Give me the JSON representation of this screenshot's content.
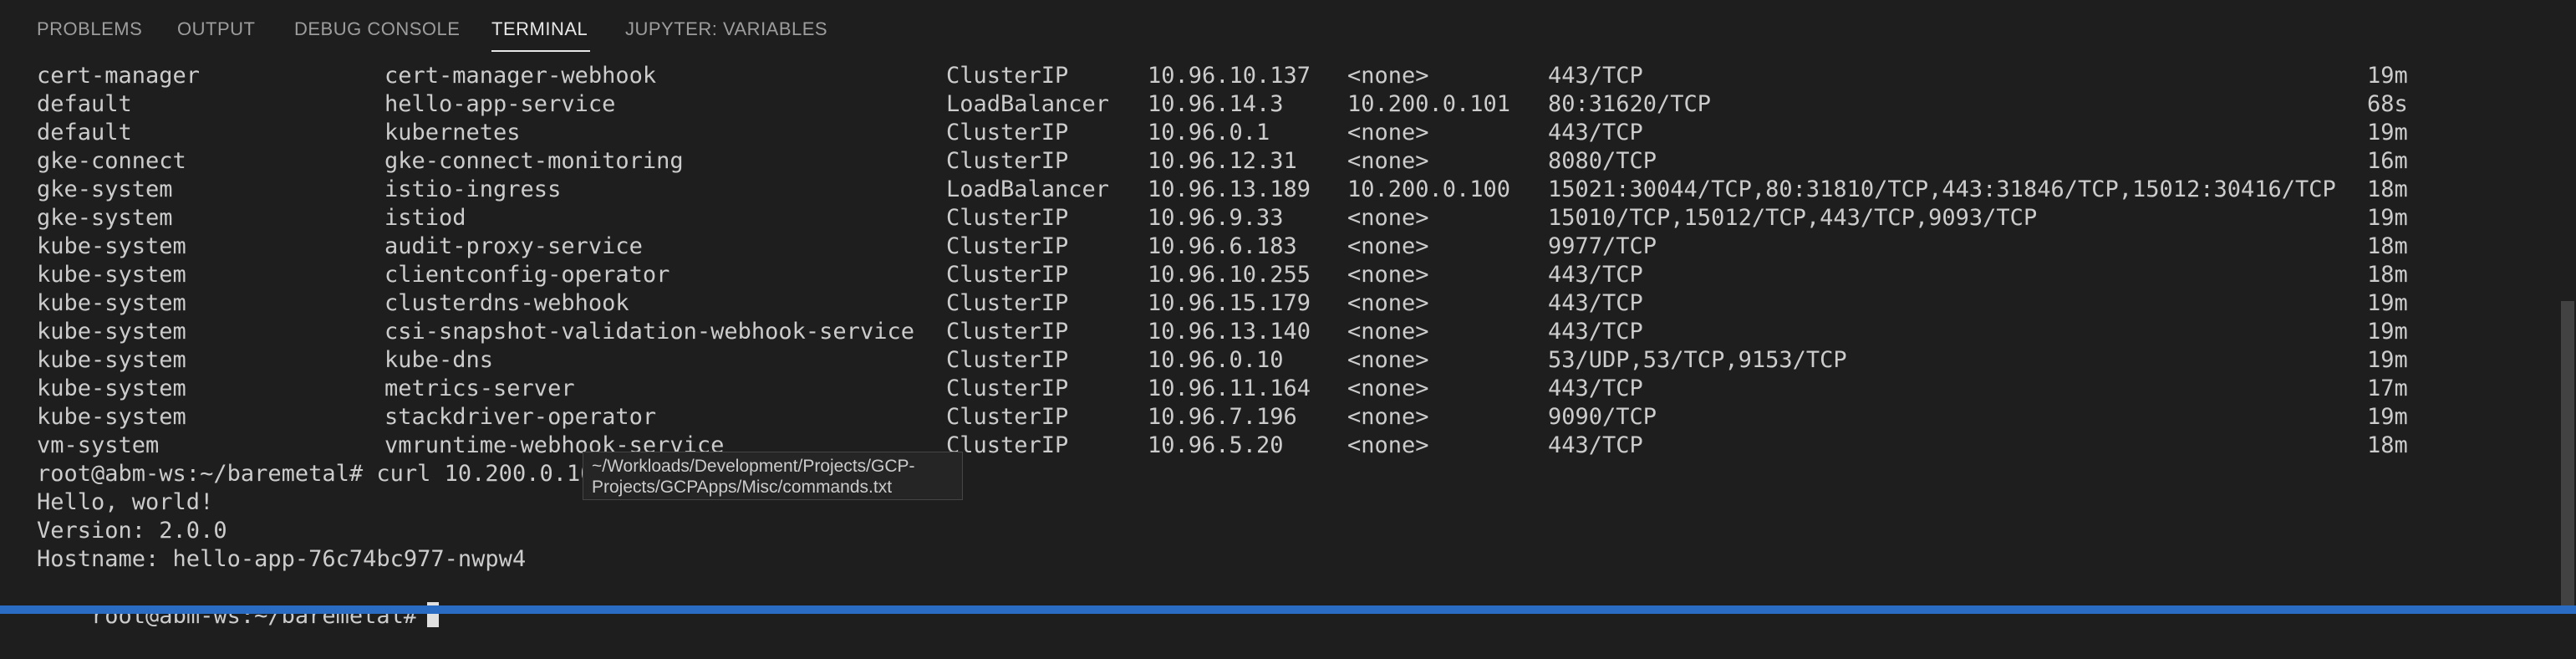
{
  "panel": {
    "tabs": [
      {
        "label": "PROBLEMS"
      },
      {
        "label": "OUTPUT"
      },
      {
        "label": "DEBUG CONSOLE"
      },
      {
        "label": "TERMINAL"
      },
      {
        "label": "JUPYTER: VARIABLES"
      }
    ],
    "active_tab": "TERMINAL"
  },
  "terminal": {
    "rows": [
      [
        "cert-manager",
        "cert-manager-webhook",
        "ClusterIP",
        "10.96.10.137",
        "<none>",
        "443/TCP",
        "19m"
      ],
      [
        "default",
        "hello-app-service",
        "LoadBalancer",
        "10.96.14.3",
        "10.200.0.101",
        "80:31620/TCP",
        "68s"
      ],
      [
        "default",
        "kubernetes",
        "ClusterIP",
        "10.96.0.1",
        "<none>",
        "443/TCP",
        "19m"
      ],
      [
        "gke-connect",
        "gke-connect-monitoring",
        "ClusterIP",
        "10.96.12.31",
        "<none>",
        "8080/TCP",
        "16m"
      ],
      [
        "gke-system",
        "istio-ingress",
        "LoadBalancer",
        "10.96.13.189",
        "10.200.0.100",
        "15021:30044/TCP,80:31810/TCP,443:31846/TCP,15012:30416/TCP",
        "18m"
      ],
      [
        "gke-system",
        "istiod",
        "ClusterIP",
        "10.96.9.33",
        "<none>",
        "15010/TCP,15012/TCP,443/TCP,9093/TCP",
        "19m"
      ],
      [
        "kube-system",
        "audit-proxy-service",
        "ClusterIP",
        "10.96.6.183",
        "<none>",
        "9977/TCP",
        "18m"
      ],
      [
        "kube-system",
        "clientconfig-operator",
        "ClusterIP",
        "10.96.10.255",
        "<none>",
        "443/TCP",
        "18m"
      ],
      [
        "kube-system",
        "clusterdns-webhook",
        "ClusterIP",
        "10.96.15.179",
        "<none>",
        "443/TCP",
        "19m"
      ],
      [
        "kube-system",
        "csi-snapshot-validation-webhook-service",
        "ClusterIP",
        "10.96.13.140",
        "<none>",
        "443/TCP",
        "19m"
      ],
      [
        "kube-system",
        "kube-dns",
        "ClusterIP",
        "10.96.0.10",
        "<none>",
        "53/UDP,53/TCP,9153/TCP",
        "19m"
      ],
      [
        "kube-system",
        "metrics-server",
        "ClusterIP",
        "10.96.11.164",
        "<none>",
        "443/TCP",
        "17m"
      ],
      [
        "kube-system",
        "stackdriver-operator",
        "ClusterIP",
        "10.96.7.196",
        "<none>",
        "9090/TCP",
        "19m"
      ],
      [
        "vm-system",
        "vmruntime-webhook-service",
        "ClusterIP",
        "10.96.5.20",
        "<none>",
        "443/TCP",
        "18m"
      ]
    ],
    "command_line": "root@abm-ws:~/baremetal# curl 10.200.0.101",
    "output_lines": [
      "Hello, world!",
      "Version: 2.0.0",
      "Hostname: hello-app-76c74bc977-nwpw4"
    ],
    "prompt": "root@abm-ws:~/baremetal#"
  },
  "tooltip": {
    "line1": "~/Workloads/Development/Projects/GCP-",
    "line2": "Projects/GCPApps/Misc/commands.txt"
  },
  "colors": {
    "background": "#1e1e1e",
    "text": "#cccccc",
    "tab_inactive": "#9d9d9d",
    "tab_active": "#e7e7e7",
    "status_bar": "#2a6cc4"
  }
}
